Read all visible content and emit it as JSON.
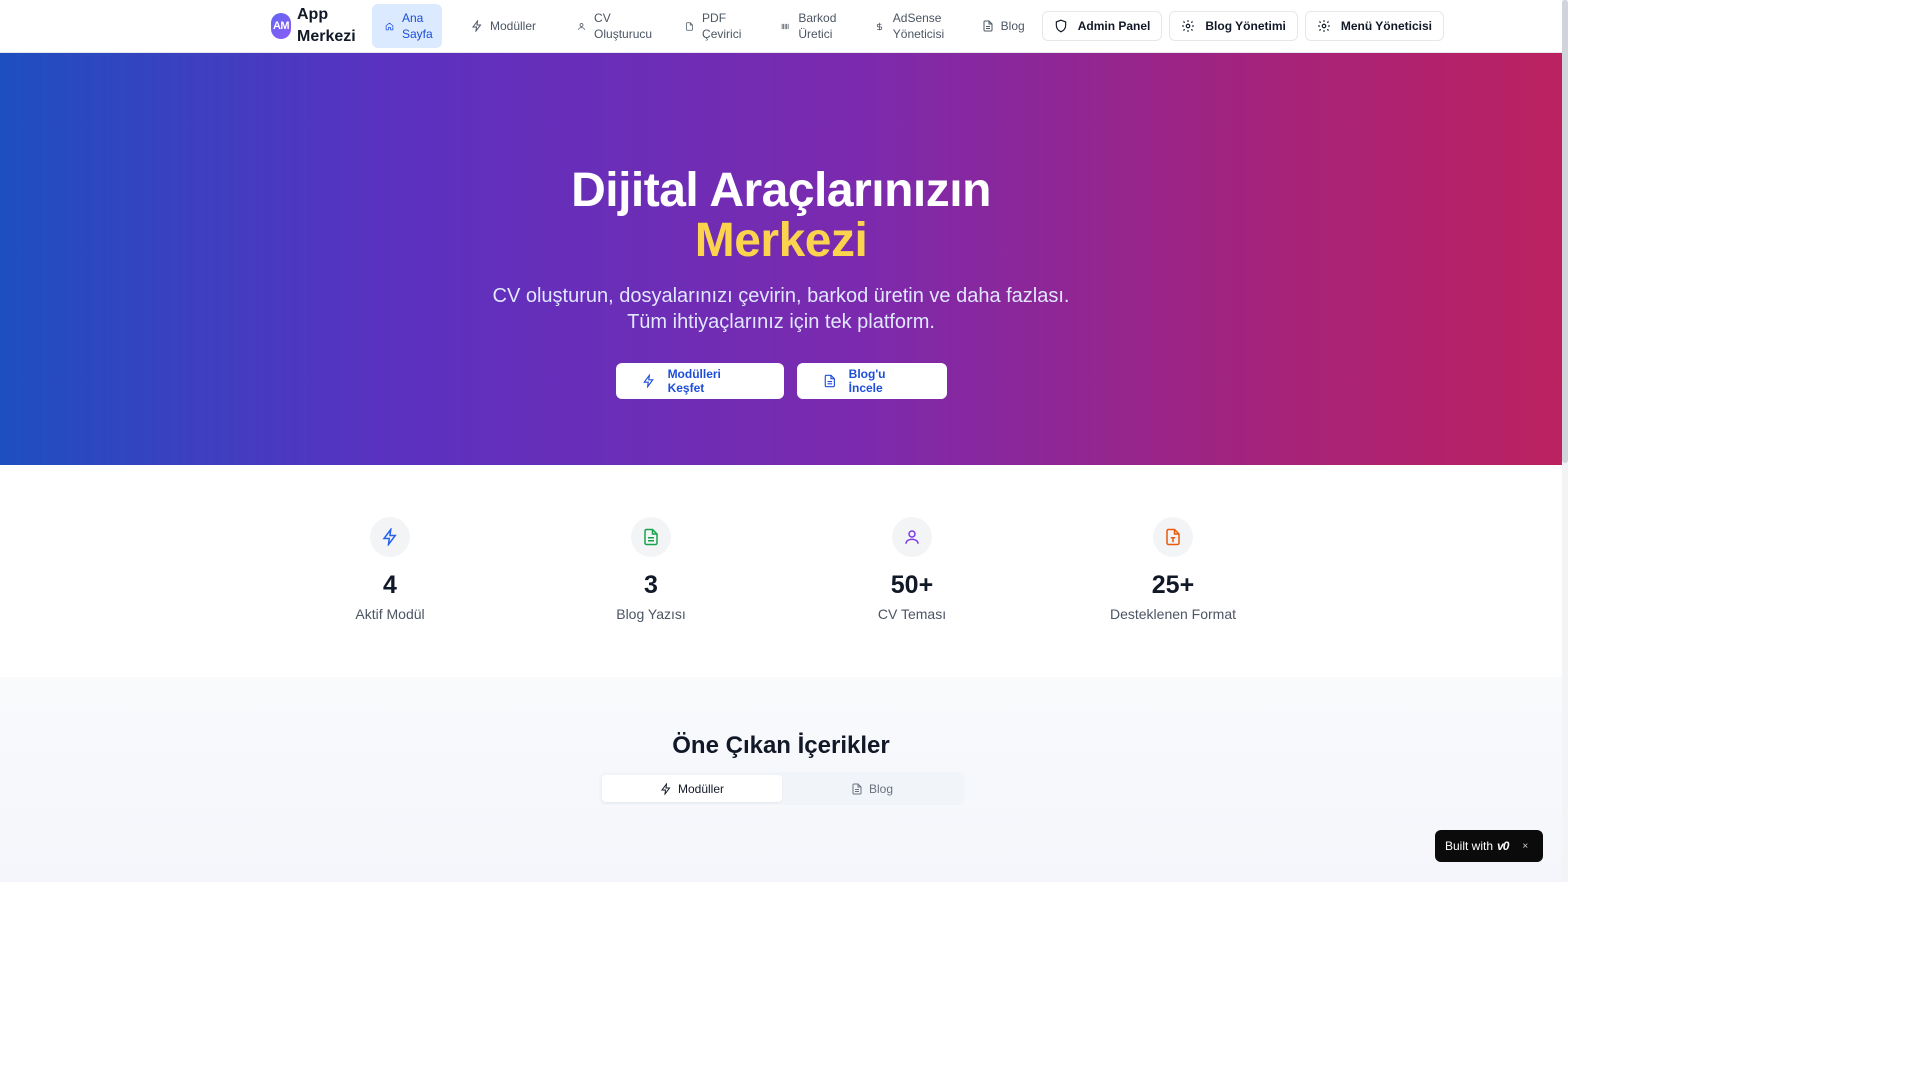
{
  "brand": {
    "badge": "AM",
    "name": "App Merkezi"
  },
  "nav": {
    "items": [
      {
        "label": "Ana Sayfa",
        "icon": "home-icon",
        "active": true
      },
      {
        "label": "Modüller",
        "icon": "zap-icon"
      },
      {
        "label": "CV Oluşturucu",
        "icon": "user-icon"
      },
      {
        "label": "PDF Çevirici",
        "icon": "file-icon"
      },
      {
        "label": "Barkod Üretici",
        "icon": "barcode-icon"
      },
      {
        "label": "AdSense Yöneticisi",
        "icon": "dollar-icon"
      },
      {
        "label": "Blog",
        "icon": "document-icon"
      }
    ],
    "buttons": [
      {
        "label": "Admin Panel",
        "icon": "shield-icon"
      },
      {
        "label": "Blog Yönetimi",
        "icon": "gear-icon"
      },
      {
        "label": "Menü Yöneticisi",
        "icon": "gear-icon"
      }
    ]
  },
  "hero": {
    "title_line1": "Dijital Araçlarınızın",
    "title_accent": "Merkezi",
    "subtitle_line1": "CV oluşturun, dosyalarınızı çevirin, barkod üretin ve daha fazlası.",
    "subtitle_line2": "Tüm ihtiyaçlarınız için tek platform.",
    "primary_button": "Modülleri Keşfet",
    "secondary_button": "Blog'u İncele"
  },
  "stats": [
    {
      "value": "4",
      "label": "Aktif Modül",
      "icon": "zap-icon",
      "color": "#2563eb"
    },
    {
      "value": "3",
      "label": "Blog Yazısı",
      "icon": "document-icon",
      "color": "#16a34a"
    },
    {
      "value": "50+",
      "label": "CV Teması",
      "icon": "user-icon",
      "color": "#7c3aed"
    },
    {
      "value": "25+",
      "label": "Desteklenen Format",
      "icon": "file-type-icon",
      "color": "#ea580c"
    }
  ],
  "featured": {
    "title": "Öne Çıkan İçerikler",
    "tabs": [
      {
        "label": "Modüller",
        "active": true
      },
      {
        "label": "Blog",
        "active": false
      }
    ]
  },
  "badge": {
    "text": "Built with",
    "logo": "v0",
    "close": "×"
  },
  "colors": {
    "accent": "#fcd34d",
    "primary": "#1d4ed8"
  }
}
